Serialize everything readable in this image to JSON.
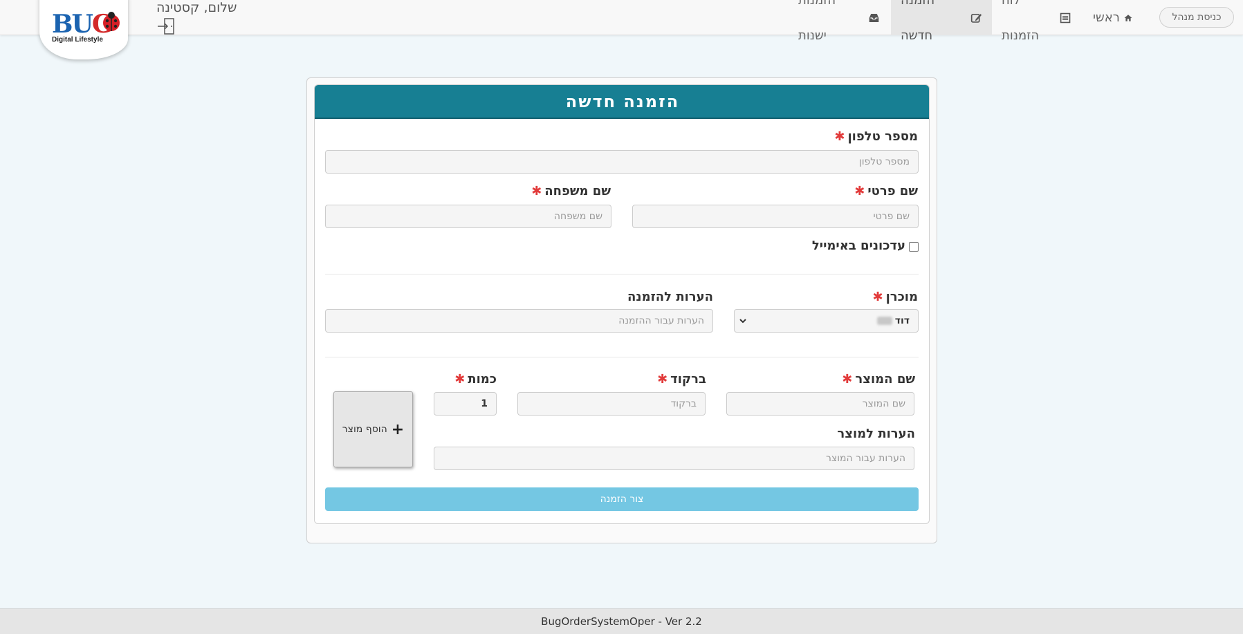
{
  "nav": {
    "admin_login": "כניסת מנהל",
    "items": [
      {
        "label": "ראשי",
        "icon": "home-icon"
      },
      {
        "label": "לוח הזמנות",
        "icon": "list-icon"
      },
      {
        "label": "הזמנה חדשה",
        "icon": "edit-icon",
        "active": true
      },
      {
        "label": "הזמנות ישנות",
        "icon": "inbox-icon"
      }
    ],
    "greeting": "שלום, קסטינה",
    "logo": {
      "brand": "BUG",
      "tagline": "Digital Lifestyle"
    }
  },
  "form": {
    "title": "הזמנה חדשה",
    "phone": {
      "label": "מספר טלפון",
      "placeholder": "מספר טלפון",
      "required": true
    },
    "first_name": {
      "label": "שם פרטי",
      "placeholder": "שם פרטי",
      "required": true
    },
    "last_name": {
      "label": "שם משפחה",
      "placeholder": "שם משפחה",
      "required": true
    },
    "email_updates": {
      "label": "עדכונים באימייל",
      "checked": false
    },
    "seller": {
      "label": "מוכרן",
      "value": "דוד",
      "required": true
    },
    "order_notes": {
      "label": "הערות להזמנה",
      "placeholder": "הערות עבור ההזמנה"
    },
    "product_name": {
      "label": "שם המוצר",
      "placeholder": "שם המוצר",
      "required": true
    },
    "barcode": {
      "label": "ברקוד",
      "placeholder": "ברקוד",
      "required": true
    },
    "quantity": {
      "label": "כמות",
      "value": "1",
      "required": true
    },
    "product_notes": {
      "label": "הערות למוצר",
      "placeholder": "הערות עבור המוצר"
    },
    "add_product": "הוסף מוצר",
    "submit": "צור הזמנה",
    "required_mark": "✱"
  },
  "footer": {
    "text": "BugOrderSystemOper - Ver 2.2"
  },
  "colors": {
    "header": "#177f93",
    "submit": "#74c7e3",
    "required": "#e23b3b",
    "background": "#f0f7fa"
  }
}
